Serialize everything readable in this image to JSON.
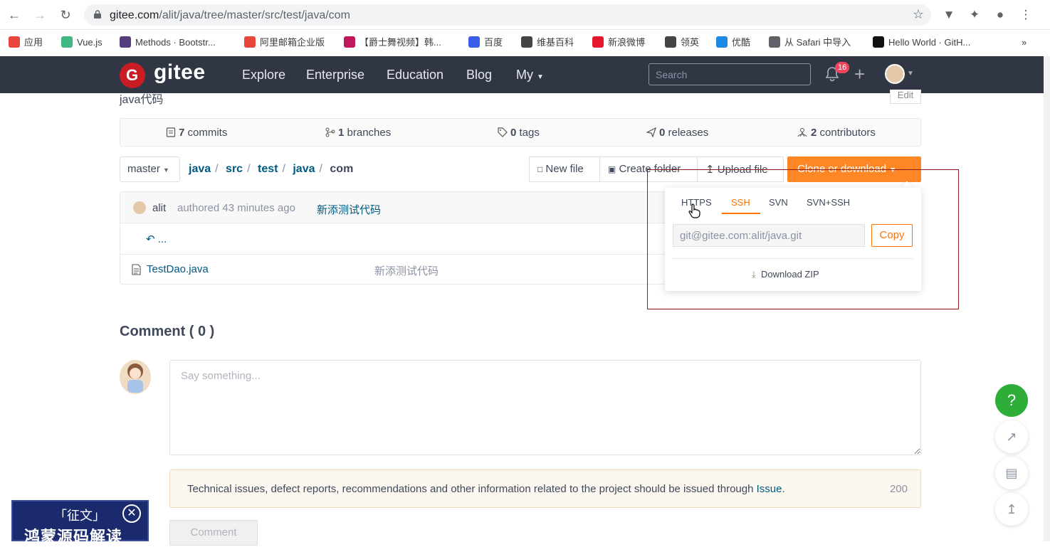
{
  "browser": {
    "url_host": "gitee.com",
    "url_path": "/alit/java/tree/master/src/test/java/com",
    "bookmarks": [
      {
        "label": "应用",
        "color": "#e8453c"
      },
      {
        "label": "Vue.js",
        "color": "#41b883"
      },
      {
        "label": "Methods · Bootstr...",
        "color": "#563d7c"
      },
      {
        "label": "阿里邮箱企业版",
        "color": "#e8453c"
      },
      {
        "label": "【爵士舞视频】韩...",
        "color": "#c2185b"
      },
      {
        "label": "百度",
        "color": "#3b5eea"
      },
      {
        "label": "维基百科",
        "color": "#444444"
      },
      {
        "label": "新浪微博",
        "color": "#e6162d"
      },
      {
        "label": "领英",
        "color": "#444444"
      },
      {
        "label": "优酷",
        "color": "#1e88e5"
      },
      {
        "label": "从 Safari 中导入",
        "color": "#5f6368"
      },
      {
        "label": "Hello World · GitH...",
        "color": "#111111"
      }
    ],
    "more": "»"
  },
  "header": {
    "logo_text": "gitee",
    "nav": [
      "Explore",
      "Enterprise",
      "Education",
      "Blog",
      "My"
    ],
    "search_placeholder": "Search",
    "notification_count": "16"
  },
  "repo": {
    "description": "java代码",
    "edit_label": "Edit",
    "stats": [
      {
        "count": "7",
        "label": "commits"
      },
      {
        "count": "1",
        "label": "branches"
      },
      {
        "count": "0",
        "label": "tags"
      },
      {
        "count": "0",
        "label": "releases"
      },
      {
        "count": "2",
        "label": "contributors"
      }
    ],
    "branch": "master",
    "breadcrumb": [
      "java",
      "src",
      "test",
      "java"
    ],
    "breadcrumb_current": "com",
    "buttons": {
      "new_file": "New file",
      "create_folder": "Create folder",
      "upload_file": "Upload file",
      "clone": "Clone or download"
    },
    "last_commit": {
      "author": "alit",
      "time": "authored 43 minutes ago",
      "message": "新添测试代码"
    },
    "parent_dir": "...",
    "files": [
      {
        "name": "TestDao.java",
        "message": "新添测试代码"
      }
    ]
  },
  "clone_dropdown": {
    "tabs": [
      "HTTPS",
      "SSH",
      "SVN",
      "SVN+SSH"
    ],
    "active_tab": "SSH",
    "url": "git@gitee.com:alit/java.git",
    "copy_label": "Copy",
    "download_zip": "Download ZIP"
  },
  "comments": {
    "title": "Comment ( 0 )",
    "placeholder": "Say something...",
    "notice": "Technical issues, defect reports, recommendations and other information related to the project should be issued through",
    "notice_link": "Issue",
    "notice_period": ".",
    "char_count": "200",
    "submit_label": "Comment"
  },
  "float_buttons": {
    "help": "?"
  },
  "promo": {
    "top": "「征文」",
    "main": "鸿蒙源码解读"
  },
  "colors": {
    "accent": "#fe7300",
    "header_bg": "#303643",
    "link": "#005980",
    "help_green": "#2ead38"
  }
}
